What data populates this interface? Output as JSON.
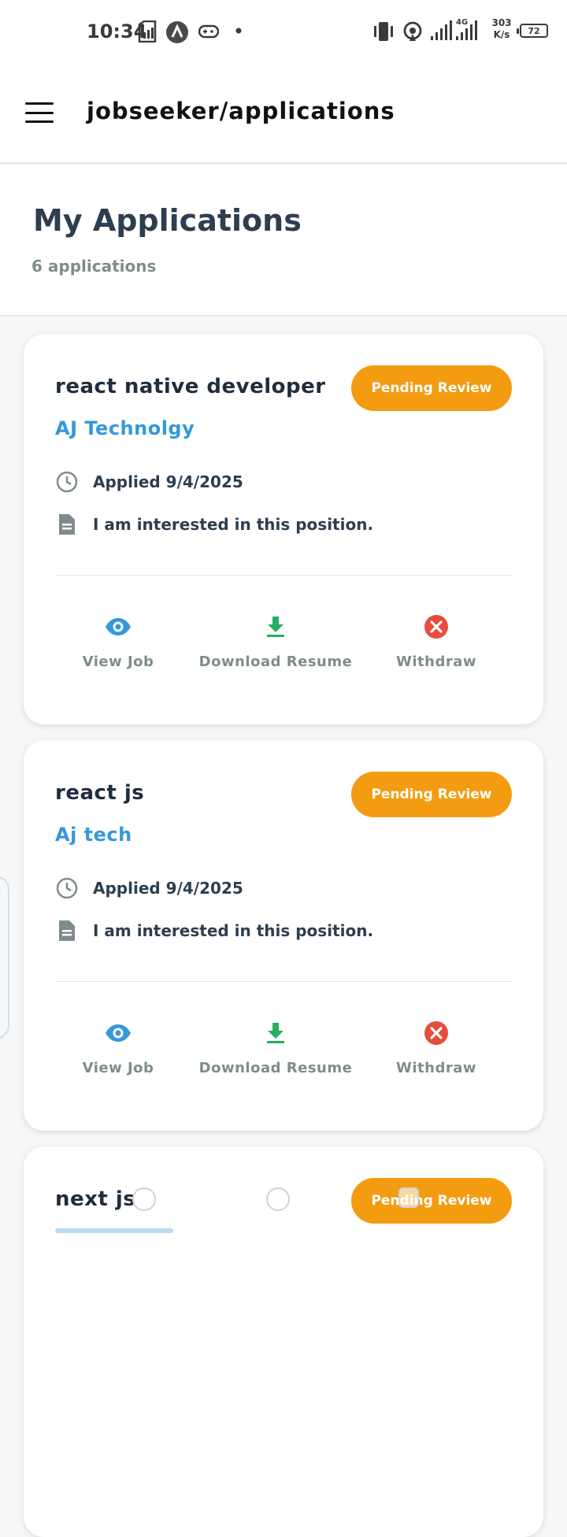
{
  "status_bar": {
    "time": "10:34",
    "speed_value": "303",
    "speed_unit": "K/s",
    "battery": "72",
    "icons": [
      "sim-card-icon",
      "a-circle-icon",
      "gamepad-icon",
      "dot-icon",
      "vibrate-icon",
      "hotspot-icon",
      "signal-icon",
      "signal-4g-icon"
    ]
  },
  "app_bar": {
    "title": "jobseeker/applications",
    "menu_icon": "hamburger-menu-icon"
  },
  "header": {
    "title": "My Applications",
    "count": "6 applications"
  },
  "colors": {
    "accent": "#3498db",
    "pending": "#f39c12",
    "download": "#27ae60",
    "withdraw": "#e74c3c",
    "text_dark": "#2c3e50",
    "text_muted": "#7f8c8d"
  },
  "applications": [
    {
      "job_title": "react native developer",
      "status": "Pending Review",
      "company": "AJ Technolgy",
      "applied": "Applied 9/4/2025",
      "note": "I am interested in this position.",
      "actions": {
        "view": "View Job",
        "download": "Download Resume",
        "withdraw": "Withdraw"
      }
    },
    {
      "job_title": "react js",
      "status": "Pending Review",
      "company": "Aj tech",
      "applied": "Applied 9/4/2025",
      "note": "I am interested in this position.",
      "actions": {
        "view": "View Job",
        "download": "Download Resume",
        "withdraw": "Withdraw"
      }
    },
    {
      "job_title": "next js",
      "status": "Pending Review"
    }
  ]
}
